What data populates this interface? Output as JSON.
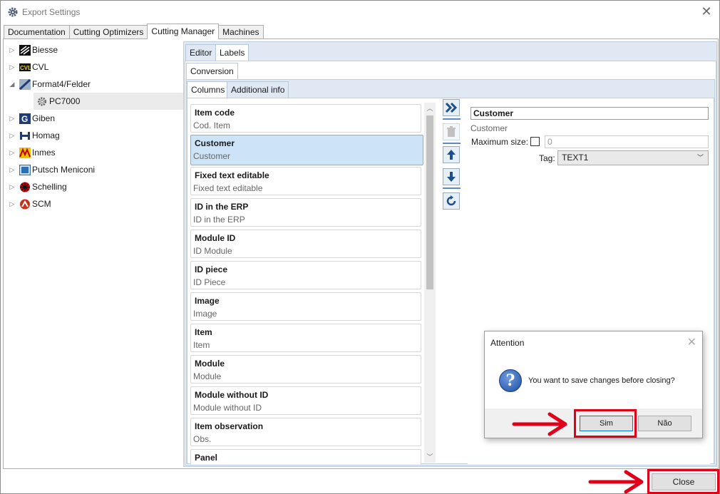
{
  "window": {
    "title": "Export Settings"
  },
  "tabs": [
    "Documentation",
    "Cutting Optimizers",
    "Cutting Manager",
    "Machines"
  ],
  "active_tab": "Cutting Manager",
  "tree": [
    {
      "label": "Biesse",
      "expanded": false,
      "logo": "biesse-logo"
    },
    {
      "label": "CVL",
      "expanded": false,
      "logo": "cvl-logo"
    },
    {
      "label": "Format4/Felder",
      "expanded": true,
      "logo": "format4-logo"
    },
    {
      "label": "PC7000",
      "child": true,
      "selected": true,
      "logo": "gear-icon"
    },
    {
      "label": "Giben",
      "expanded": false,
      "logo": "giben-logo"
    },
    {
      "label": "Homag",
      "expanded": false,
      "logo": "homag-logo"
    },
    {
      "label": "Inmes",
      "expanded": false,
      "logo": "inmes-logo"
    },
    {
      "label": "Putsch Meniconi",
      "expanded": false,
      "logo": "putsch-logo"
    },
    {
      "label": "Schelling",
      "expanded": false,
      "logo": "schelling-logo"
    },
    {
      "label": "SCM",
      "expanded": false,
      "logo": "scm-logo"
    }
  ],
  "subtabs": {
    "editor": "Editor",
    "labels": "Labels",
    "conversion": "Conversion",
    "columns": "Columns",
    "additional": "Additional info"
  },
  "columns": [
    {
      "title": "Item code",
      "sub": "Cod. Item"
    },
    {
      "title": "Customer",
      "sub": "Customer",
      "selected": true
    },
    {
      "title": "Fixed text editable",
      "sub": "Fixed text editable"
    },
    {
      "title": "ID in the ERP",
      "sub": "ID in the ERP"
    },
    {
      "title": "Module ID",
      "sub": "ID Module"
    },
    {
      "title": "ID piece",
      "sub": "ID Piece"
    },
    {
      "title": "Image",
      "sub": "Image"
    },
    {
      "title": "Item",
      "sub": "Item"
    },
    {
      "title": "Module",
      "sub": "Module"
    },
    {
      "title": "Module without ID",
      "sub": "Module without ID"
    },
    {
      "title": "Item observation",
      "sub": "Obs."
    },
    {
      "title": "Panel",
      "sub": ""
    }
  ],
  "properties": {
    "name": "Customer",
    "sub": "Customer",
    "max_size_label": "Maximum size:",
    "max_size_value": "0",
    "tag_label": "Tag:",
    "tag_value": "TEXT1"
  },
  "dialog": {
    "title": "Attention",
    "message": "You want to save changes before closing?",
    "yes": "Sim",
    "no": "Não"
  },
  "close_label": "Close",
  "colors": {
    "highlight": "#e0001a",
    "selected_item": "#cde3f7",
    "panel_bg": "#dfe8f3"
  }
}
